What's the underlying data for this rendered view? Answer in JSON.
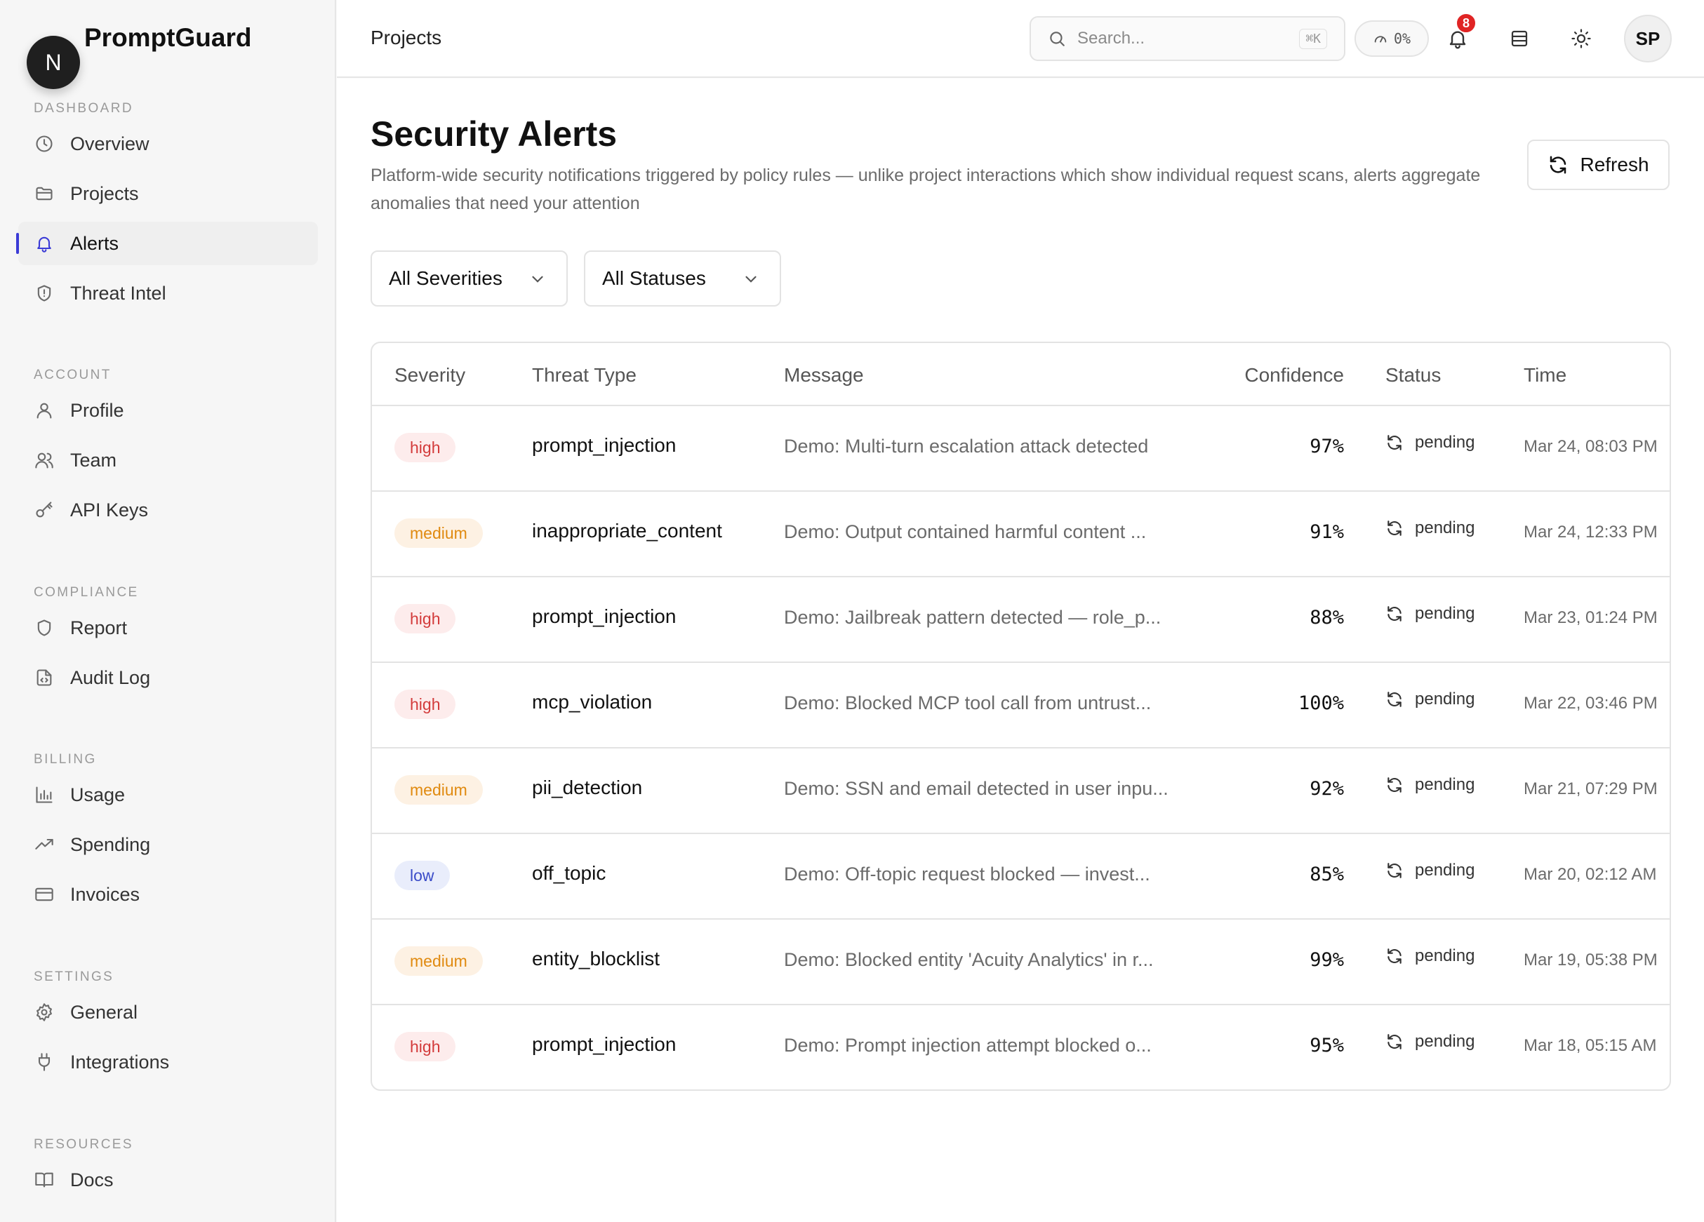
{
  "brand": {
    "logo_letter": "N",
    "name": "PromptGuard"
  },
  "sidebar": {
    "sections": [
      {
        "title": "DASHBOARD",
        "items": [
          {
            "label": "Overview",
            "icon": "clock-icon"
          },
          {
            "label": "Projects",
            "icon": "folder-icon"
          },
          {
            "label": "Alerts",
            "icon": "bell-icon",
            "active": true
          },
          {
            "label": "Threat Intel",
            "icon": "shield-alert-icon"
          }
        ]
      },
      {
        "title": "ACCOUNT",
        "items": [
          {
            "label": "Profile",
            "icon": "user-icon"
          },
          {
            "label": "Team",
            "icon": "users-icon"
          },
          {
            "label": "API Keys",
            "icon": "key-icon"
          }
        ]
      },
      {
        "title": "COMPLIANCE",
        "items": [
          {
            "label": "Report",
            "icon": "shield-icon"
          },
          {
            "label": "Audit Log",
            "icon": "file-code-icon"
          }
        ]
      },
      {
        "title": "BILLING",
        "items": [
          {
            "label": "Usage",
            "icon": "bar-chart-icon"
          },
          {
            "label": "Spending",
            "icon": "trending-up-icon"
          },
          {
            "label": "Invoices",
            "icon": "credit-card-icon"
          }
        ]
      },
      {
        "title": "SETTINGS",
        "items": [
          {
            "label": "General",
            "icon": "gear-icon"
          },
          {
            "label": "Integrations",
            "icon": "plug-icon"
          }
        ]
      },
      {
        "title": "RESOURCES",
        "items": [
          {
            "label": "Docs",
            "icon": "book-icon"
          }
        ]
      }
    ]
  },
  "topbar": {
    "breadcrumb": "Projects",
    "search_placeholder": "Search...",
    "search_shortcut": "⌘K",
    "usage_percent": "0%",
    "notification_count": "8",
    "avatar_initials": "SP"
  },
  "page": {
    "title": "Security Alerts",
    "description": "Platform-wide security notifications triggered by policy rules — unlike project interactions which show individual request scans, alerts aggregate anomalies that need your attention",
    "refresh_label": "Refresh",
    "filters": {
      "severity": "All Severities",
      "status": "All Statuses"
    }
  },
  "table": {
    "headers": [
      "Severity",
      "Threat Type",
      "Message",
      "Confidence",
      "Status",
      "Time"
    ],
    "rows": [
      {
        "severity": "high",
        "threat": "prompt_injection",
        "message": "Demo: Multi-turn escalation attack detected",
        "confidence": "97%",
        "status": "pending",
        "time": "Mar 24, 08:03 PM"
      },
      {
        "severity": "medium",
        "threat": "inappropriate_content",
        "message": "Demo: Output contained harmful content ...",
        "confidence": "91%",
        "status": "pending",
        "time": "Mar 24, 12:33 PM"
      },
      {
        "severity": "high",
        "threat": "prompt_injection",
        "message": "Demo: Jailbreak pattern detected — role_p...",
        "confidence": "88%",
        "status": "pending",
        "time": "Mar 23, 01:24 PM"
      },
      {
        "severity": "high",
        "threat": "mcp_violation",
        "message": "Demo: Blocked MCP tool call from untrust...",
        "confidence": "100%",
        "status": "pending",
        "time": "Mar 22, 03:46 PM"
      },
      {
        "severity": "medium",
        "threat": "pii_detection",
        "message": "Demo: SSN and email detected in user inpu...",
        "confidence": "92%",
        "status": "pending",
        "time": "Mar 21, 07:29 PM"
      },
      {
        "severity": "low",
        "threat": "off_topic",
        "message": "Demo: Off-topic request blocked — invest...",
        "confidence": "85%",
        "status": "pending",
        "time": "Mar 20, 02:12 AM"
      },
      {
        "severity": "medium",
        "threat": "entity_blocklist",
        "message": "Demo: Blocked entity 'Acuity Analytics' in r...",
        "confidence": "99%",
        "status": "pending",
        "time": "Mar 19, 05:38 PM"
      },
      {
        "severity": "high",
        "threat": "prompt_injection",
        "message": "Demo: Prompt injection attempt blocked o...",
        "confidence": "95%",
        "status": "pending",
        "time": "Mar 18, 05:15 AM"
      }
    ]
  },
  "colors": {
    "accent": "#3b3bd6",
    "high": "#d33b3b",
    "medium": "#e08a10",
    "low": "#3a4bc8",
    "badge": "#e02424"
  }
}
